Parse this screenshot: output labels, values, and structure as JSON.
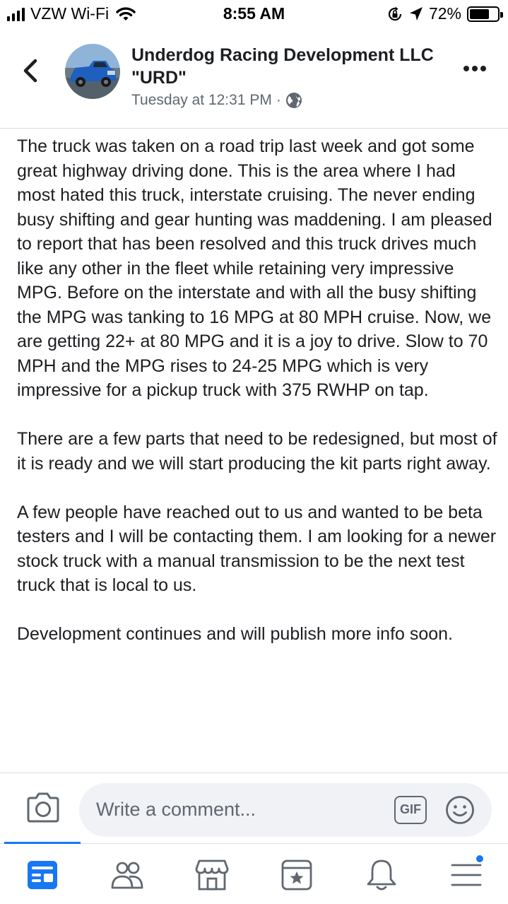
{
  "status_bar": {
    "carrier": "VZW Wi-Fi",
    "time": "8:55 AM",
    "battery_percent": "72%",
    "battery_level": 0.72,
    "icons": [
      "signal-icon",
      "wifi-icon",
      "rotation-lock-icon",
      "location-icon",
      "battery-icon"
    ]
  },
  "post": {
    "page_name": "Underdog Racing Development LLC \"URD\"",
    "timestamp": "Tuesday at 12:31 PM",
    "separator": "·",
    "privacy_icon": "globe-icon",
    "paragraphs": [
      "The truck was taken on a road trip last week and got some great highway driving done.  This is the area where I had most hated this truck, interstate cruising.  The never ending busy shifting and gear hunting was maddening.   I am pleased to report that has been resolved and this truck drives much like any other in the fleet while retaining very impressive MPG.   Before on the interstate and with all the busy shifting the MPG was tanking to 16 MPG at 80 MPH cruise.  Now, we are getting 22+ at 80 MPG and it is a joy to drive.  Slow to 70 MPH and the MPG rises to 24-25 MPG which is very impressive for a pickup truck with 375 RWHP on tap.",
      "There are a few parts that need to be redesigned, but most of it is ready and we will start producing the kit parts right away.",
      "A few people have reached out to us and wanted to be beta testers and I will be contacting them.  I am looking for a newer stock truck with a manual transmission to be the next test truck that is local to us.",
      "Development continues and will publish more info soon."
    ]
  },
  "comment_bar": {
    "placeholder": "Write a comment...",
    "gif_label": "GIF"
  },
  "tab_bar": {
    "tabs": [
      "home-icon",
      "friends-icon",
      "marketplace-icon",
      "pages-icon",
      "notifications-icon",
      "menu-icon"
    ],
    "active": "home-icon"
  },
  "colors": {
    "accent": "#1877f2",
    "text": "#1c1e21",
    "secondary": "#606770",
    "input_bg": "#f0f2f5"
  }
}
